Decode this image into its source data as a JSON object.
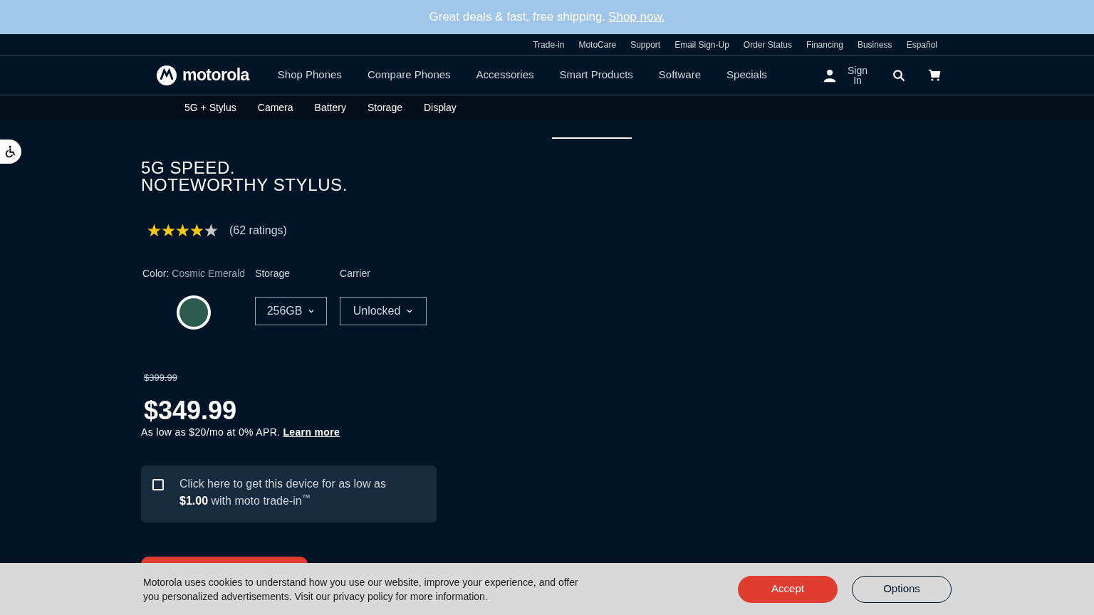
{
  "banner": {
    "text": "Great deals & fast, free shipping.",
    "link": "Shop now."
  },
  "utility_links": [
    "Trade-in",
    "MotoCare",
    "Support",
    "Email Sign-Up",
    "Order Status",
    "Financing",
    "Business",
    "Español"
  ],
  "logo": "motorola",
  "nav": [
    "Shop Phones",
    "Compare Phones",
    "Accessories",
    "Smart Products",
    "Software",
    "Specials"
  ],
  "sign_in": "Sign In",
  "subnav": [
    "5G + Stylus",
    "Camera",
    "Battery",
    "Storage",
    "Display"
  ],
  "headline": [
    "5G SPEED.",
    "NOTEWORTHY STYLUS."
  ],
  "rating": {
    "stars": 4,
    "text": "(62 ratings)"
  },
  "color": {
    "label": "Color:",
    "value": "Cosmic Emerald",
    "swatches": [
      {
        "color": "#2d5a4f",
        "selected": true
      }
    ]
  },
  "storage": {
    "label": "Storage",
    "value": "256GB"
  },
  "carrier": {
    "label": "Carrier",
    "value": "Unlocked"
  },
  "price": {
    "original": "$399.99",
    "current": "$349.99",
    "financing": "As low as $20/mo at 0% APR.",
    "link": "Learn more"
  },
  "trade_in": {
    "checked": false,
    "text": "Click here to get this device for as low as **$1.00** with moto trade-in$^{™}$"
  },
  "cookie": {
    "text": "Motorola uses cookies to understand how you use our website, improve your experience, and offer you personalized advertisements. Visit our privacy policy for more information.",
    "accept": "Accept",
    "options": "Options"
  }
}
